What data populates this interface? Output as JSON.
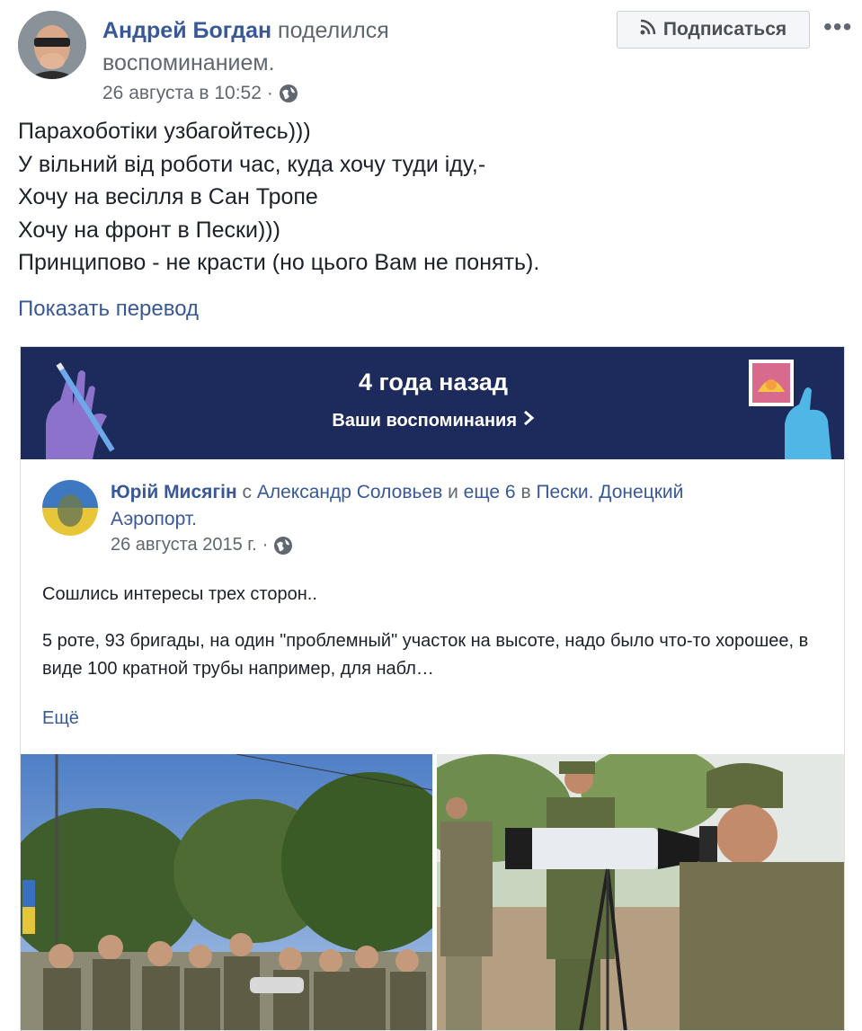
{
  "post": {
    "author": "Андрей Богдан",
    "action": "поделился воспоминанием.",
    "timestamp": "26 августа в 10:52",
    "separator": "·",
    "subscribe_label": "Подписаться",
    "more_label": "•••",
    "text_lines": [
      "Парахоботіки узбагойтесь)))",
      "У вільний від роботи час, куда хочу туди іду,-",
      "Хочу на весілля в Сан Тропе",
      "Хочу на фронт в Пески)))",
      "Принципово - не красти (но цього Вам не понять)."
    ],
    "translate_label": "Показать перевод"
  },
  "memory": {
    "years_ago": "4 года назад",
    "link_label": "Ваши воспоминания",
    "shared": {
      "author": "Юрій Мисягін",
      "with_word": "с",
      "tagged": "Александр Соловьев",
      "and_word": "и",
      "others": "еще 6",
      "in_word": "в",
      "place_line1": "Пески. Донецкий",
      "place_line2": "Аэропорт.",
      "date": "26 августа 2015 г.",
      "separator": "·",
      "text1": "Сошлись интересы трех сторон..",
      "text2": "5 роте, 93 бригады, на один \"проблемный\" участок на высоте, надо было что-то хорошее, в виде 100 кратной трубы например, для набл…",
      "more_label": "Ещё"
    }
  },
  "colors": {
    "link": "#385898",
    "banner": "#1d2a5c",
    "meta_gray": "#606770"
  }
}
